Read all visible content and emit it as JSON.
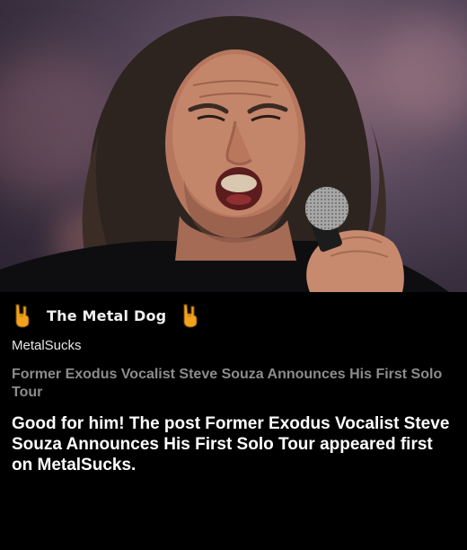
{
  "feed": {
    "title": "The Metal Dog",
    "icon": "rock-horns-icon",
    "accent_color": "#f2a31c"
  },
  "post": {
    "source": "MetalSucks",
    "headline": "Former Exodus Vocalist Steve Souza Announces His First Solo Tour",
    "body": "Good for him! The post Former Exodus Vocalist Steve Souza Announces His First Solo Tour appeared first on MetalSucks.",
    "headline_color": "#8c8c8c",
    "body_color": "#ffffff"
  }
}
